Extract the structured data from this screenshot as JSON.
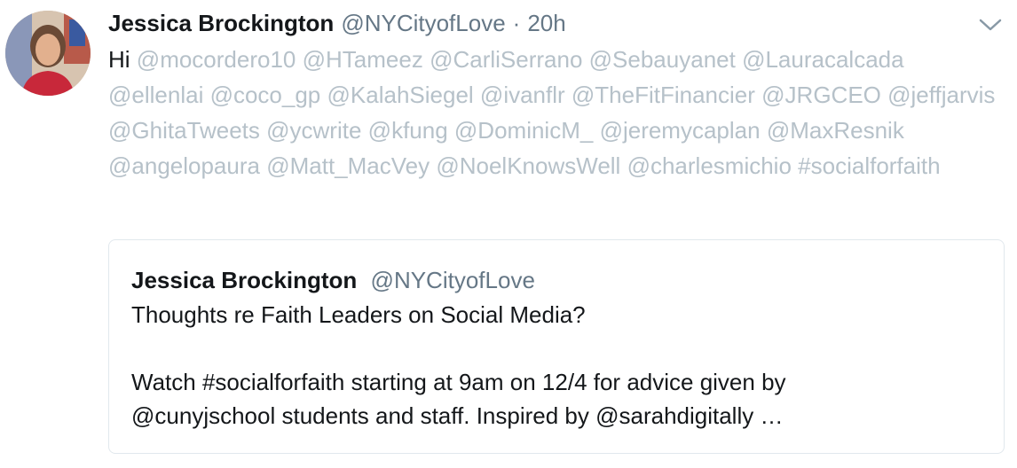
{
  "tweet": {
    "author_name": "Jessica Brockington",
    "author_handle": "@NYCityofLove",
    "separator": "·",
    "time": "20h",
    "avatar_icon": "profile-photo",
    "caret_icon": "chevron-down-icon",
    "greeting": "Hi",
    "mentions": [
      "@mocordero10",
      "@HTameez",
      "@CarliSerrano",
      "@Sebauyanet",
      "@Lauracalcada",
      "@ellenlai",
      "@coco_gp",
      "@KalahSiegel",
      "@ivanflr",
      "@TheFitFinancier",
      "@JRGCEO",
      "@jeffjarvis",
      "@GhitaTweets",
      "@ycwrite",
      "@kfung",
      "@DominicM_",
      "@jeremycaplan",
      "@MaxResnik",
      "@angelopaura",
      "@Matt_MacVey",
      "@NoelKnowsWell",
      "@charlesmichio"
    ],
    "hashtag": "#socialforfaith",
    "colors": {
      "text": "#14171a",
      "secondary": "#657786",
      "mention": "#b6c1c9",
      "border": "#e1e8ed"
    }
  },
  "quoted": {
    "author_name": "Jessica Brockington",
    "author_handle": "@NYCityofLove",
    "line1": "Thoughts re Faith Leaders on Social Media?",
    "line2": "Watch #socialforfaith starting at 9am on 12/4 for advice given by",
    "line3": "@cunyjschool students and staff. Inspired by @sarahdigitally …"
  }
}
